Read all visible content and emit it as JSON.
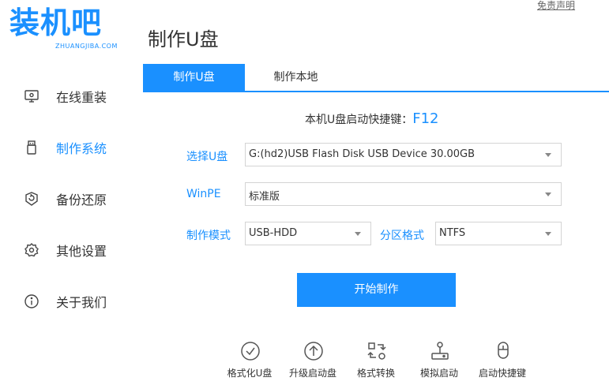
{
  "logo": {
    "title": "装机吧",
    "subtitle": "ZHUANGJIBA.COM"
  },
  "header": {
    "disclaimer": "免责声明",
    "page_title": "制作U盘"
  },
  "sidebar": {
    "items": [
      {
        "label": "在线重装",
        "icon": "monitor-icon",
        "active": false
      },
      {
        "label": "制作系统",
        "icon": "usb-drive-icon",
        "active": true
      },
      {
        "label": "备份还原",
        "icon": "backup-restore-icon",
        "active": false
      },
      {
        "label": "其他设置",
        "icon": "gear-icon",
        "active": false
      },
      {
        "label": "关于我们",
        "icon": "info-icon",
        "active": false
      }
    ]
  },
  "tabs": [
    {
      "label": "制作U盘",
      "active": true
    },
    {
      "label": "制作本地",
      "active": false
    }
  ],
  "shortcut": {
    "label": "本机U盘启动快捷键：",
    "key": "F12"
  },
  "form": {
    "usb": {
      "label": "选择U盘",
      "value": "G:(hd2)USB Flash Disk USB Device 30.00GB"
    },
    "winpe": {
      "label": "WinPE",
      "value": "标准版"
    },
    "mode": {
      "label": "制作模式",
      "value": "USB-HDD"
    },
    "partition": {
      "label": "分区格式",
      "value": "NTFS"
    }
  },
  "start_button": {
    "label": "开始制作"
  },
  "tools": [
    {
      "label": "格式化U盘",
      "icon": "check-circle-icon"
    },
    {
      "label": "升级启动盘",
      "icon": "upgrade-arrow-icon"
    },
    {
      "label": "格式转换",
      "icon": "convert-icon"
    },
    {
      "label": "模拟启动",
      "icon": "joystick-icon"
    },
    {
      "label": "启动快捷键",
      "icon": "mouse-icon"
    }
  ],
  "colors": {
    "accent": "#1a90ff",
    "text": "#333333",
    "border": "#d4d4d4"
  }
}
